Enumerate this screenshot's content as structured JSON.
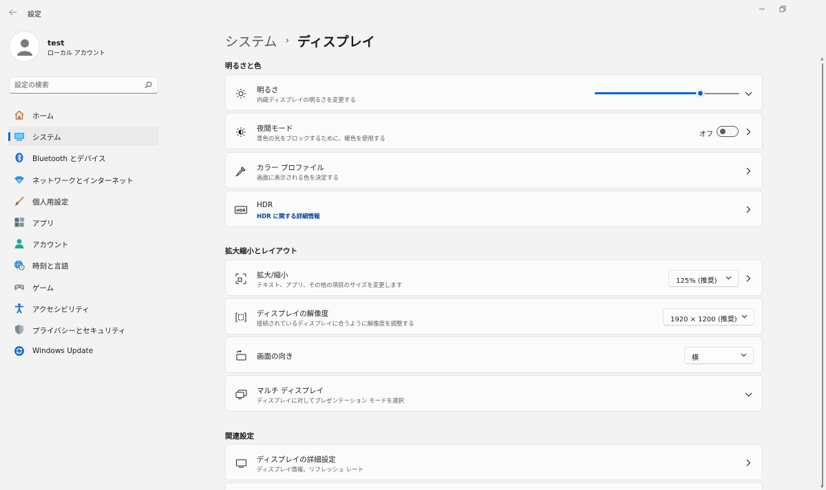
{
  "window": {
    "title": "設定"
  },
  "profile": {
    "name": "test",
    "account_type": "ローカル アカウント"
  },
  "search": {
    "placeholder": "設定の検索"
  },
  "nav": {
    "items": [
      {
        "label": "ホーム",
        "icon": "home-icon"
      },
      {
        "label": "システム",
        "icon": "monitor-icon",
        "active": true
      },
      {
        "label": "Bluetooth とデバイス",
        "icon": "bluetooth-icon"
      },
      {
        "label": "ネットワークとインターネット",
        "icon": "wifi-icon"
      },
      {
        "label": "個人用設定",
        "icon": "brush-icon"
      },
      {
        "label": "アプリ",
        "icon": "apps-icon"
      },
      {
        "label": "アカウント",
        "icon": "person-icon"
      },
      {
        "label": "時刻と言語",
        "icon": "globe-clock-icon"
      },
      {
        "label": "ゲーム",
        "icon": "gamepad-icon"
      },
      {
        "label": "アクセシビリティ",
        "icon": "accessibility-icon"
      },
      {
        "label": "プライバシーとセキュリティ",
        "icon": "shield-icon"
      },
      {
        "label": "Windows Update",
        "icon": "update-icon"
      }
    ]
  },
  "breadcrumb": {
    "parent": "システム",
    "separator": "›",
    "current": "ディスプレイ"
  },
  "sections": {
    "brightness_color": {
      "title": "明るさと色",
      "brightness": {
        "title": "明るさ",
        "subtitle": "内蔵ディスプレイの明るさを変更する",
        "level": 0.73
      },
      "night_light": {
        "title": "夜間モード",
        "subtitle": "青色の光をブロックするために、暖色を使用する",
        "state_label": "オフ",
        "on": false
      },
      "color_profile": {
        "title": "カラー プロファイル",
        "subtitle": "画面に表示される色を決定する"
      },
      "hdr": {
        "title": "HDR",
        "link": "HDR に関する詳細情報",
        "icon_text": "HDR"
      }
    },
    "scale_layout": {
      "title": "拡大縮小とレイアウト",
      "scale": {
        "title": "拡大/縮小",
        "subtitle": "テキスト、アプリ、その他の項目のサイズを変更します",
        "value": "125% (推奨)"
      },
      "resolution": {
        "title": "ディスプレイの解像度",
        "subtitle": "接続されているディスプレイに合うように解像度を調整する",
        "value": "1920 × 1200 (推奨)"
      },
      "orientation": {
        "title": "画面の向き",
        "value": "横"
      },
      "multi_display": {
        "title": "マルチ ディスプレイ",
        "subtitle": "ディスプレイに対してプレゼンテーション モードを選択"
      }
    },
    "related": {
      "title": "関連設定",
      "advanced_display": {
        "title": "ディスプレイの詳細設定",
        "subtitle": "ディスプレイ情報、リフレッシュ レート"
      }
    }
  },
  "colors": {
    "accent": "#0067c0",
    "background": "#f3f3f3",
    "card": "#fbfbfb"
  }
}
